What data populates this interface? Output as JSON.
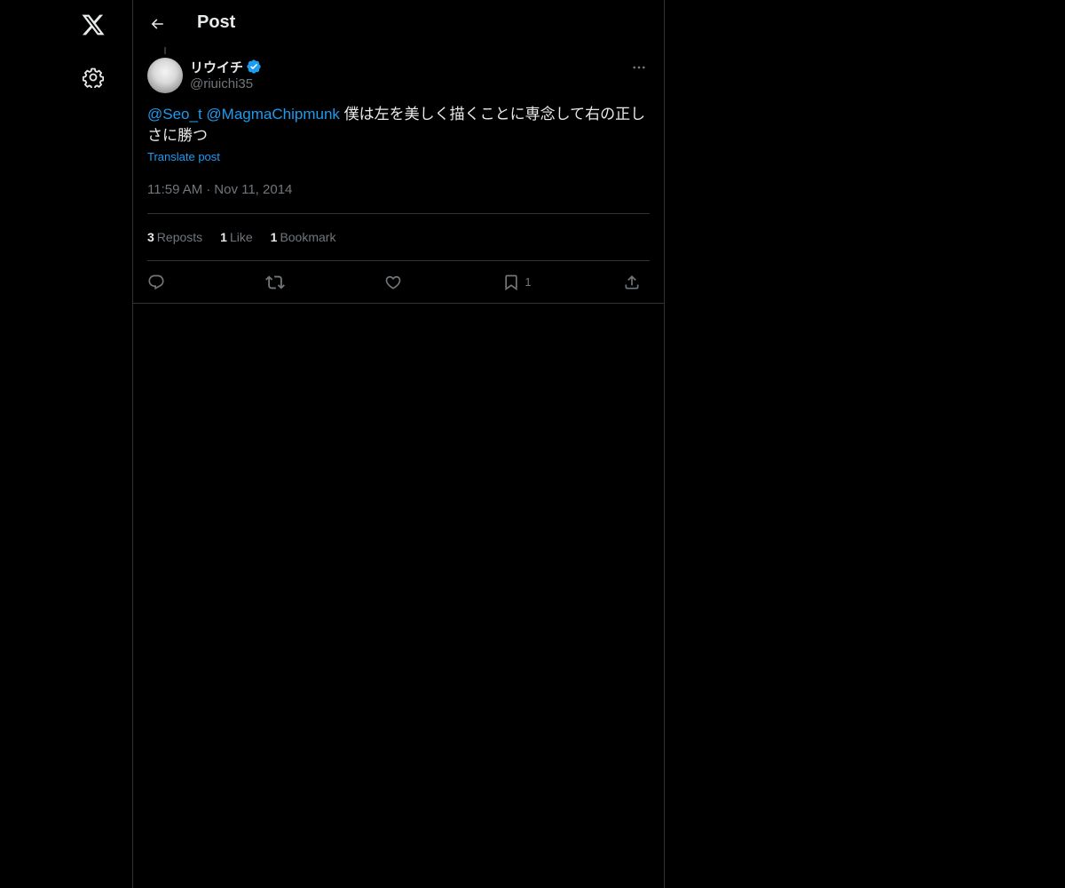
{
  "header": {
    "title": "Post"
  },
  "post": {
    "author": {
      "display_name": "リウイチ",
      "handle": "@riuichi35",
      "verified": true
    },
    "text": {
      "mention_1": "@Seo_t",
      "mention_2": "@MagmaChipmunk",
      "body": " 僕は左を美しく描くことに専念して右の正しさに勝つ"
    },
    "translate_label": "Translate post",
    "time": "11:59 AM",
    "separator": "·",
    "date": "Nov 11, 2014",
    "stats": {
      "reposts_count": "3",
      "reposts_label": "Reposts",
      "likes_count": "1",
      "likes_label": "Like",
      "bookmarks_count": "1",
      "bookmarks_label": "Bookmark"
    },
    "actions": {
      "bookmark_count": "1"
    }
  },
  "colors": {
    "background": "#000000",
    "text": "#e7e9ea",
    "secondary_text": "#71767b",
    "accent": "#1d9bf0",
    "border": "#2f3336"
  },
  "icons": {
    "logo": "x-logo-icon",
    "settings": "gear-icon",
    "back": "arrow-left-icon",
    "verified": "verified-badge-icon",
    "more": "more-horizontal-icon",
    "reply": "reply-icon",
    "repost": "repost-icon",
    "like": "heart-icon",
    "bookmark": "bookmark-icon",
    "share": "share-icon"
  }
}
